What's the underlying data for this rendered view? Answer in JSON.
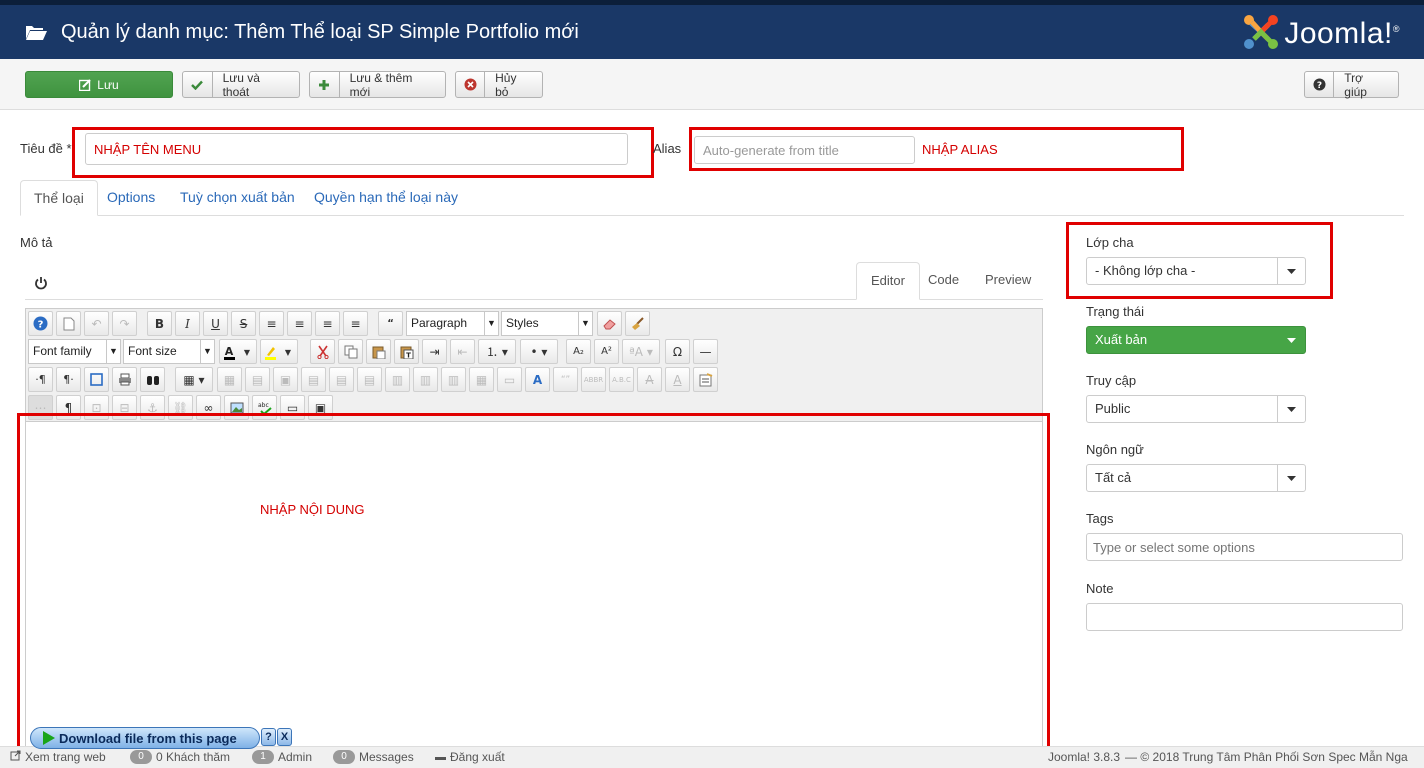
{
  "header": {
    "page_title": "Quản lý danh mục: Thêm Thể loại SP Simple Portfolio mới",
    "logo_text": "Joomla!",
    "logo_mark": "®"
  },
  "toolbar": {
    "save": "Lưu",
    "save_close": "Lưu và thoát",
    "save_new": "Lưu & thêm mới",
    "cancel": "Hủy bỏ",
    "help": "Trợ giúp"
  },
  "form": {
    "title_label": "Tiêu đề *",
    "title_value": "NHẬP TÊN MENU",
    "alias_label": "Alias",
    "alias_placeholder": "Auto-generate from title",
    "alias_note": "NHẬP ALIAS"
  },
  "tabs": [
    "Thể loại",
    "Options",
    "Tuỳ chọn xuất bản",
    "Quyền hạn thể loại này"
  ],
  "editor": {
    "description_label": "Mô tả",
    "tabs": [
      "Editor",
      "Code",
      "Preview"
    ],
    "paragraph_select": "Paragraph",
    "styles_select": "Styles",
    "font_family_select": "Font family",
    "font_size_select": "Font size",
    "content_note": "NHẬP NỘI DUNG"
  },
  "sidebar": {
    "parent_label": "Lớp cha",
    "parent_value": "- Không lớp cha -",
    "status_label": "Trạng thái",
    "status_value": "Xuất bản",
    "access_label": "Truy cập",
    "access_value": "Public",
    "language_label": "Ngôn ngữ",
    "language_value": "Tất cả",
    "tags_label": "Tags",
    "tags_placeholder": "Type or select some options",
    "note_label": "Note"
  },
  "footer": {
    "view_site": "Xem trang web",
    "visitors_count": "0",
    "visitors_label": "0 Khách thăm",
    "admin_count": "1",
    "admin_label": "Admin",
    "messages_count": "0",
    "messages_label": "Messages",
    "logout": "Đăng xuất",
    "version": "Joomla! 3.8.3",
    "copyright": "— © 2018 Trung Tâm Phân Phối Sơn Spec Mẫn Nga"
  },
  "download_bar": {
    "label": "Download file from this page",
    "help": "?",
    "close": "X"
  },
  "colors": {
    "header_bg": "#1a3867",
    "save_green": "#46a546",
    "annotation_red": "#e00000",
    "link_blue": "#2a69b8"
  }
}
